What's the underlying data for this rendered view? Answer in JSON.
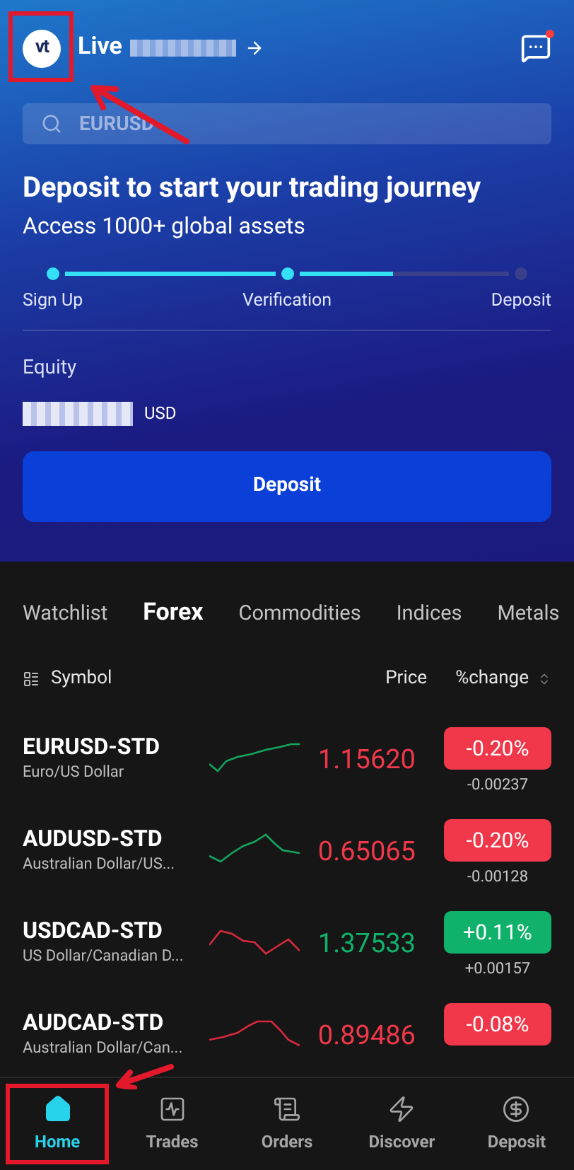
{
  "header": {
    "account_label": "Live",
    "logo_text": "vt",
    "logo_highlighted": true,
    "has_notification": true
  },
  "search": {
    "placeholder": "EURUSD"
  },
  "promo": {
    "title": "Deposit to start your trading journey",
    "subtitle": "Access 1000+ global assets",
    "steps": [
      {
        "label": "Sign Up",
        "reached": true
      },
      {
        "label": "Verification",
        "reached": true
      },
      {
        "label": "Deposit",
        "reached": false
      }
    ],
    "segments": [
      {
        "level": 1
      },
      {
        "level": 0.45
      }
    ]
  },
  "equity": {
    "label": "Equity",
    "currency": "USD"
  },
  "deposit_button": "Deposit",
  "tabs": [
    {
      "label": "Watchlist",
      "selected": false
    },
    {
      "label": "Forex",
      "selected": true
    },
    {
      "label": "Commodities",
      "selected": false
    },
    {
      "label": "Indices",
      "selected": false
    },
    {
      "label": "Metals",
      "selected": false
    }
  ],
  "columns": [
    "Symbol",
    "Price",
    "%change"
  ],
  "rows": [
    {
      "symbol": "EURUSD-STD",
      "name": "Euro/US Dollar",
      "price_rising": false,
      "sparkline_rising": true,
      "price": "1.15620",
      "change_pct": "-0.20%",
      "change": "-0.00237"
    },
    {
      "symbol": "AUDUSD-STD",
      "name": "Australian Dollar/US...",
      "price_rising": false,
      "sparkline_rising": true,
      "price": "0.65065",
      "change_pct": "-0.20%",
      "change": "-0.00128"
    },
    {
      "symbol": "USDCAD-STD",
      "name": "US Dollar/Canadian D...",
      "price_rising": true,
      "sparkline_rising": false,
      "price": "1.37533",
      "change_pct": "+0.11%",
      "change": "+0.00157"
    },
    {
      "symbol": "AUDCAD-STD",
      "name": "Australian Dollar/Can...",
      "price_rising": false,
      "sparkline_rising": false,
      "price": "0.89486",
      "change_pct": "-0.08%"
    }
  ],
  "nav": [
    {
      "label": "Home",
      "selected": true,
      "highlighted": true
    },
    {
      "label": "Trades",
      "selected": false,
      "highlighted": false
    },
    {
      "label": "Orders",
      "selected": false,
      "highlighted": false
    },
    {
      "label": "Discover",
      "selected": false,
      "highlighted": false
    },
    {
      "label": "Deposit",
      "selected": false,
      "highlighted": false
    }
  ]
}
